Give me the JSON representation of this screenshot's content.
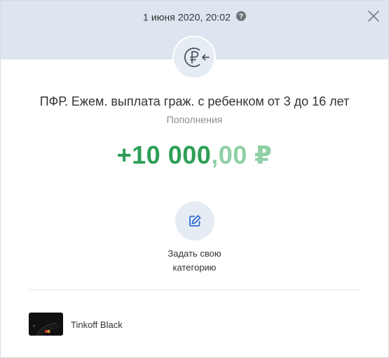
{
  "header": {
    "date": "1 июня 2020, 20:02",
    "help_icon": "question-circle-icon",
    "close_icon": "close-icon"
  },
  "operation": {
    "icon": "ruble-incoming-icon",
    "title": "ПФР. Ежем. выплата граж. с ребенком от 3 до 16 лет",
    "category": "Пополнения"
  },
  "amount": {
    "whole": "+10 000",
    "fraction": ",00",
    "currency": "₽",
    "colors": {
      "whole": "#2e9e57",
      "fraction": "#8fd0a6"
    }
  },
  "set_category": {
    "icon": "edit-pencil-icon",
    "line1": "Задать свою",
    "line2": "категорию"
  },
  "card": {
    "icon": "card-thumbnail",
    "name": "Tinkoff Black"
  }
}
